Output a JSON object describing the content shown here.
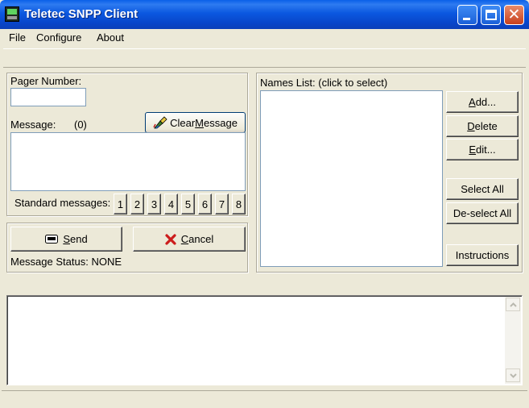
{
  "window": {
    "title": "Teletec SNPP Client"
  },
  "menu": {
    "items": [
      "File",
      "Configure",
      "About"
    ]
  },
  "message_panel": {
    "pager_label": "Pager Number:",
    "pager_value": "",
    "message_label": "Message:",
    "message_count": "(0)",
    "clear_button": {
      "pre": "Clear ",
      "acc": "M",
      "post": "essage"
    },
    "message_value": "",
    "standard_label": "Standard messages:",
    "standard_buttons": [
      "1",
      "2",
      "3",
      "4",
      "5",
      "6",
      "7",
      "8"
    ]
  },
  "send_panel": {
    "send_button": {
      "acc": "S",
      "post": "end"
    },
    "cancel_button": {
      "acc": "C",
      "post": "ancel"
    },
    "status_text": "Message Status: NONE"
  },
  "names_panel": {
    "label": "Names List:  (click to select)",
    "buttons": {
      "add": {
        "acc": "A",
        "post": "dd..."
      },
      "delete": {
        "acc": "D",
        "post": "elete"
      },
      "edit": {
        "acc": "E",
        "post": "dit..."
      },
      "select_all": "Select All",
      "deselect_all": "De-select All",
      "instructions": "Instructions"
    }
  },
  "log": {
    "text": ""
  },
  "colors": {
    "titlebar": "#0a5fe8",
    "window_bg": "#ece9d8",
    "cancel_x": "#cc1c1c"
  }
}
